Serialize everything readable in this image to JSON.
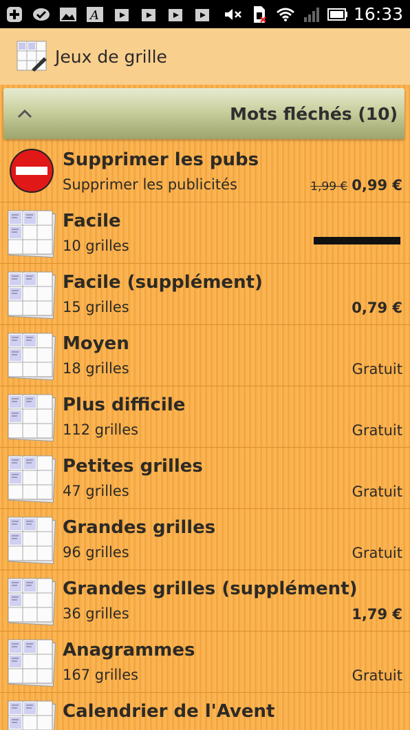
{
  "status_bar": {
    "time": "16:33",
    "left_icons": [
      "plus-icon",
      "check-bubble-icon",
      "image-icon",
      "font-app-icon",
      "play-store-icon",
      "play-store-icon",
      "play-store-icon",
      "play-store-icon"
    ],
    "right_icons": [
      "mute-icon",
      "sim-blocked-icon",
      "wifi-icon",
      "signal-icon",
      "battery-icon"
    ]
  },
  "action_bar": {
    "title": "Jeux de grille",
    "icon": "crossword-app-icon"
  },
  "section": {
    "title": "Mots fléchés (10)",
    "expanded_icon": "chevron-up-icon"
  },
  "items": [
    {
      "title": "Supprimer les pubs",
      "subtitle": "Supprimer les publicités",
      "old_price": "1,99 €",
      "price": "0,99 €",
      "icon": "no-entry-icon"
    },
    {
      "title": "Facile",
      "subtitle": "10 grilles",
      "price": "",
      "progress": 1.0,
      "icon": "grid-thumbnail-icon"
    },
    {
      "title": "Facile (supplément)",
      "subtitle": "15 grilles",
      "price": "0,79 €",
      "icon": "grid-thumbnail-icon"
    },
    {
      "title": "Moyen",
      "subtitle": "18 grilles",
      "price": "Gratuit",
      "icon": "grid-thumbnail-icon"
    },
    {
      "title": "Plus difficile",
      "subtitle": "112 grilles",
      "price": "Gratuit",
      "icon": "grid-thumbnail-icon"
    },
    {
      "title": "Petites grilles",
      "subtitle": "47 grilles",
      "price": "Gratuit",
      "icon": "grid-thumbnail-icon"
    },
    {
      "title": "Grandes grilles",
      "subtitle": "96 grilles",
      "price": "Gratuit",
      "icon": "grid-thumbnail-icon"
    },
    {
      "title": "Grandes grilles (supplément)",
      "subtitle": "36 grilles",
      "price": "1,79 €",
      "icon": "grid-thumbnail-icon"
    },
    {
      "title": "Anagrammes",
      "subtitle": "167 grilles",
      "price": "Gratuit",
      "icon": "grid-thumbnail-icon"
    },
    {
      "title": "Calendrier de l'Avent",
      "subtitle": "",
      "price": "",
      "icon": "grid-thumbnail-icon"
    }
  ],
  "colors": {
    "background": "#f9ad45",
    "action_bar": "#f9cf8e",
    "section_header": "#c9cf9e",
    "text": "#2d2a25"
  }
}
